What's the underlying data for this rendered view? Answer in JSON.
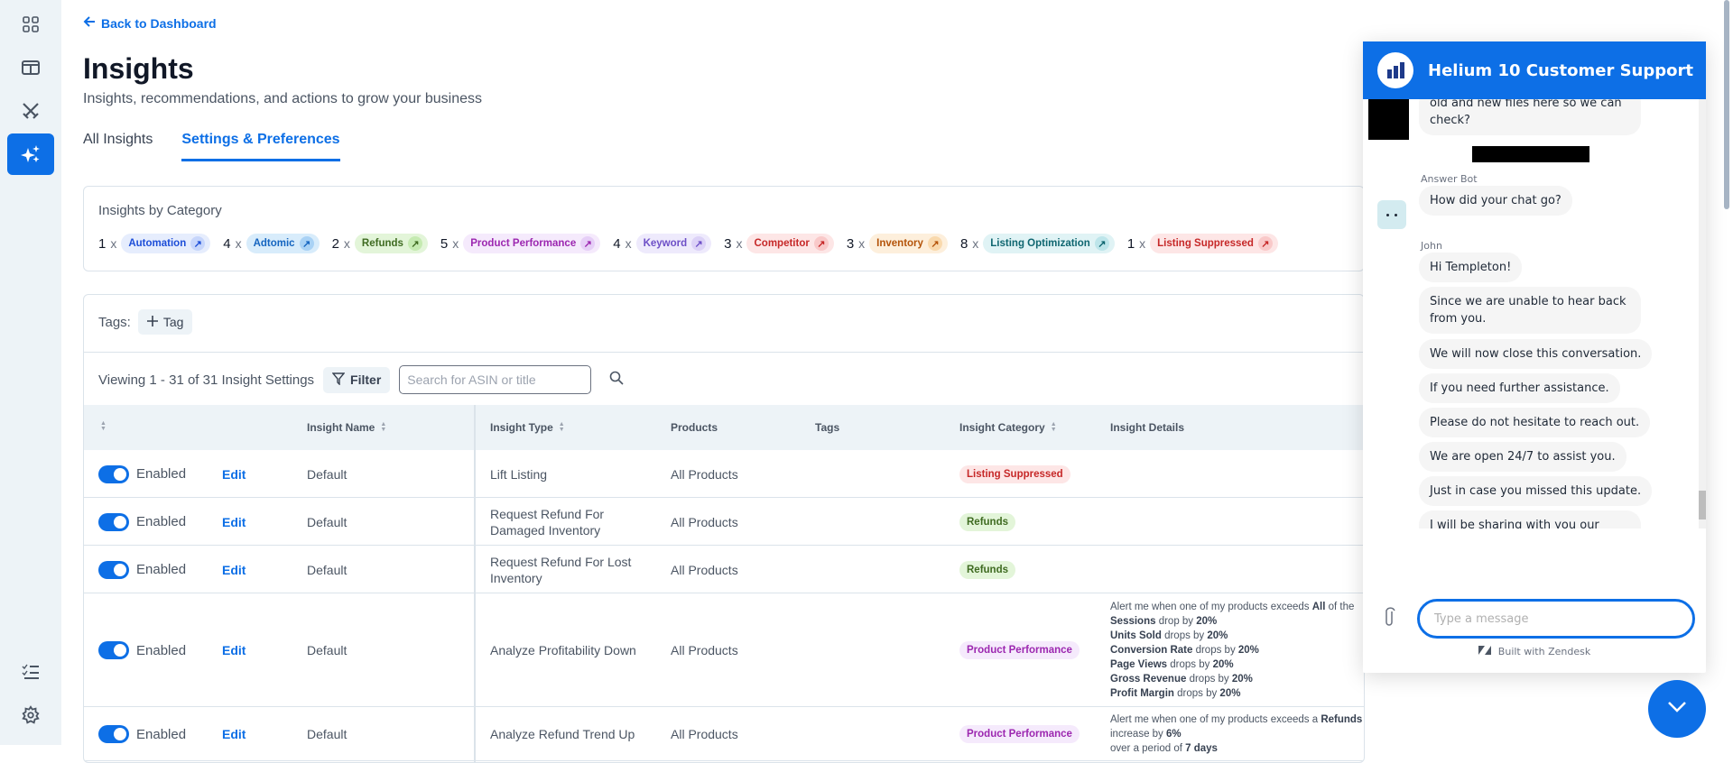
{
  "sidebar": {
    "items": [
      {
        "name": "dashboard",
        "icon": "grid-icon"
      },
      {
        "name": "layout",
        "icon": "layout-panel-icon"
      },
      {
        "name": "battles",
        "icon": "crossed-swords-icon"
      },
      {
        "name": "insights",
        "icon": "sparkles-icon",
        "active": true
      },
      {
        "name": "checklist",
        "icon": "checklist-icon"
      },
      {
        "name": "settings",
        "icon": "gear-icon"
      }
    ]
  },
  "header": {
    "back_label": "Back to Dashboard",
    "title": "Insights",
    "subtitle": "Insights, recommendations, and actions to grow your business"
  },
  "tabs": [
    {
      "label": "All Insights",
      "active": false
    },
    {
      "label": "Settings & Preferences",
      "active": true
    }
  ],
  "categories": {
    "title": "Insights by Category",
    "items": [
      {
        "count": "1",
        "x": "x",
        "label": "Automation",
        "fg": "#1d4ed8",
        "bg": "#e6edfd",
        "abg": "#c7d6fb"
      },
      {
        "count": "4",
        "x": "x",
        "label": "Adtomic",
        "fg": "#1565c0",
        "bg": "#d8ecfb",
        "abg": "#a9d2f5"
      },
      {
        "count": "2",
        "x": "x",
        "label": "Refunds",
        "fg": "#3f6b21",
        "bg": "#e3f5d9",
        "abg": "#c5eab1"
      },
      {
        "count": "5",
        "x": "x",
        "label": "Product Performance",
        "fg": "#9c27b0",
        "bg": "#f5eafc",
        "abg": "#e6cff7"
      },
      {
        "count": "4",
        "x": "x",
        "label": "Keyword",
        "fg": "#6d4fc7",
        "bg": "#eeeafc",
        "abg": "#dcd2f7"
      },
      {
        "count": "3",
        "x": "x",
        "label": "Competitor",
        "fg": "#c62828",
        "bg": "#fde6e6",
        "abg": "#f9c9c9"
      },
      {
        "count": "3",
        "x": "x",
        "label": "Inventory",
        "fg": "#b45309",
        "bg": "#fdefdc",
        "abg": "#f9d9ad"
      },
      {
        "count": "8",
        "x": "x",
        "label": "Listing Optimization",
        "fg": "#0f6670",
        "bg": "#e0f3f5",
        "abg": "#bde5ea"
      },
      {
        "count": "1",
        "x": "x",
        "label": "Listing Suppressed",
        "fg": "#c62828",
        "bg": "#fde6e6",
        "abg": "#f9c9c9"
      }
    ]
  },
  "toolbar": {
    "tags_label": "Tags:",
    "add_tag_label": "Tag",
    "viewing_text": "Viewing 1 - 31 of 31 Insight Settings",
    "filter_label": "Filter",
    "search_placeholder": "Search for ASIN or title",
    "search_value": ""
  },
  "table": {
    "columns": [
      "",
      "Insight Name",
      "Insight Type",
      "Products",
      "Tags",
      "Insight Category",
      "Insight Details"
    ],
    "rows": [
      {
        "status": "Enabled",
        "edit": "Edit",
        "name": "Default",
        "type": "Lift Listing",
        "products": "All Products",
        "tags": "",
        "category": "Listing Suppressed",
        "cat_fg": "#c62828",
        "cat_bg": "#fde6e6",
        "details": []
      },
      {
        "status": "Enabled",
        "edit": "Edit",
        "name": "Default",
        "type": "Request Refund For Damaged Inventory",
        "products": "All Products",
        "tags": "",
        "category": "Refunds",
        "cat_fg": "#3f6b21",
        "cat_bg": "#e3f5d9",
        "details": []
      },
      {
        "status": "Enabled",
        "edit": "Edit",
        "name": "Default",
        "type": "Request Refund For Lost Inventory",
        "products": "All Products",
        "tags": "",
        "category": "Refunds",
        "cat_fg": "#3f6b21",
        "cat_bg": "#e3f5d9",
        "details": []
      },
      {
        "status": "Enabled",
        "edit": "Edit",
        "name": "Default",
        "type": "Analyze Profitability Down",
        "products": "All Products",
        "tags": "",
        "category": "Product Performance",
        "cat_fg": "#9c27b0",
        "cat_bg": "#f5eafc",
        "details": [
          {
            "pre": "Alert me when one of my products exceeds ",
            "bold": "All",
            "post": " of the"
          },
          {
            "pre": "",
            "bold": "Sessions",
            "post": " drop by ",
            "bold2": "20%"
          },
          {
            "pre": "",
            "bold": "Units Sold",
            "post": " drops by ",
            "bold2": "20%"
          },
          {
            "pre": "",
            "bold": "Conversion Rate",
            "post": " drops by ",
            "bold2": "20%"
          },
          {
            "pre": "",
            "bold": "Page Views",
            "post": " drops by ",
            "bold2": "20%"
          },
          {
            "pre": "",
            "bold": "Gross Revenue",
            "post": " drops by ",
            "bold2": "20%"
          },
          {
            "pre": "",
            "bold": "Profit Margin",
            "post": " drops by ",
            "bold2": "20%"
          }
        ]
      },
      {
        "status": "Enabled",
        "edit": "Edit",
        "name": "Default",
        "type": "Analyze Refund Trend Up",
        "products": "All Products",
        "tags": "",
        "category": "Product Performance",
        "cat_fg": "#9c27b0",
        "cat_bg": "#f5eafc",
        "details": [
          {
            "pre": "Alert me when one of my products exceeds a ",
            "bold": "Refunds",
            "post": " increase by ",
            "bold2": "6%"
          },
          {
            "pre": "over a period of ",
            "bold": "7 days",
            "post": ""
          }
        ],
        "extra": "-"
      }
    ]
  },
  "chat": {
    "title": "Helium 10 Customer Support",
    "partial_message": "old and new files here so we can check?",
    "bot_name": "Answer Bot",
    "bot_message": "How did your chat go?",
    "agent_name": "John",
    "agent_messages": [
      "Hi Templeton!",
      "Since we are unable to hear back from you.",
      "We will now close this conversation.",
      "If you need further assistance.",
      "Please do not hesitate to reach out.",
      "We are open 24/7 to assist you.",
      "Just in case you missed this update.",
      "I will be sharing with you our latest blog post about the Listing Builder tool with AI."
    ],
    "input_placeholder": "Type a message",
    "input_value": "",
    "footer": "Built with Zendesk"
  }
}
